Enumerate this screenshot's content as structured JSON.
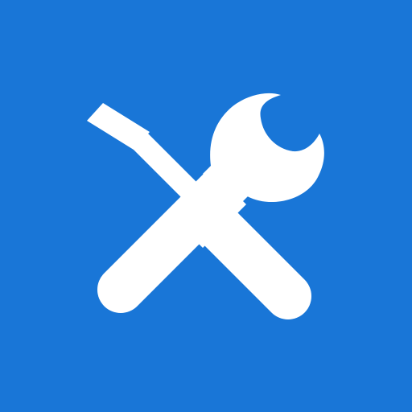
{
  "app_icon": {
    "icon": "tools-icon",
    "parts": [
      "wrench-icon",
      "screwdriver-icon"
    ],
    "colors": {
      "background": "#1976d7",
      "glyph": "#ffffff"
    }
  }
}
